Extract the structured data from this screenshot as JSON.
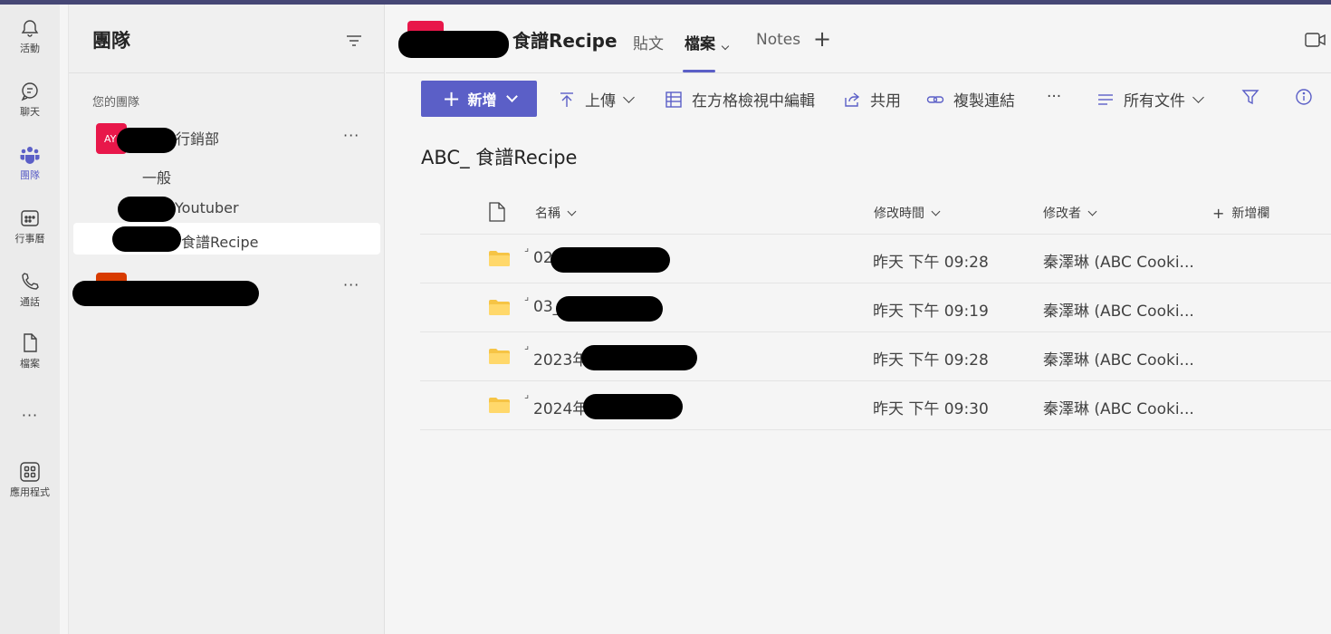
{
  "rail": {
    "items": [
      {
        "label": "活動"
      },
      {
        "label": "聊天"
      },
      {
        "label": "團隊"
      },
      {
        "label": "行事曆"
      },
      {
        "label": "通話"
      },
      {
        "label": "檔案"
      },
      {
        "label": "應用程式"
      }
    ],
    "more": "···"
  },
  "teams": {
    "title": "團隊",
    "section_label": "您的團隊",
    "team1": {
      "avatar_text": "AY",
      "name_suffix": "行銷部",
      "more": "···"
    },
    "channels": [
      {
        "label": "一般"
      },
      {
        "label": "Youtuber"
      },
      {
        "label": "食譜Recipe"
      }
    ],
    "team2": {
      "more": "···"
    }
  },
  "channel": {
    "title": "食譜Recipe",
    "tabs": [
      {
        "label": "貼文"
      },
      {
        "label": "檔案"
      },
      {
        "label": "Notes"
      }
    ],
    "add_tab": "+"
  },
  "toolbar": {
    "new_label": "新增",
    "upload": "上傳",
    "grid_edit": "在方格檢視中編輯",
    "share": "共用",
    "copy_link": "複製連結",
    "more": "···",
    "view": "所有文件"
  },
  "library": {
    "title": "ABC_ 食譜Recipe",
    "columns": {
      "name": "名稱",
      "modified": "修改時間",
      "modified_by": "修改者",
      "add_column": "新增欄"
    },
    "rows": [
      {
        "name": "02",
        "modified": "昨天 下午 09:28",
        "modified_by": "秦澤琳 (ABC Cooki..."
      },
      {
        "name": "03_",
        "modified": "昨天 下午 09:19",
        "modified_by": "秦澤琳 (ABC Cooki..."
      },
      {
        "name": "2023年",
        "modified": "昨天 下午 09:28",
        "modified_by": "秦澤琳 (ABC Cooki..."
      },
      {
        "name": "2024年",
        "modified": "昨天 下午 09:30",
        "modified_by": "秦澤琳 (ABC Cooki..."
      }
    ]
  },
  "colors": {
    "accent": "#5b5fc7",
    "topbar": "#464775",
    "team1_avatar": "#e8174a",
    "team2_avatar": "#d83b01",
    "folder": "#f6c445"
  }
}
